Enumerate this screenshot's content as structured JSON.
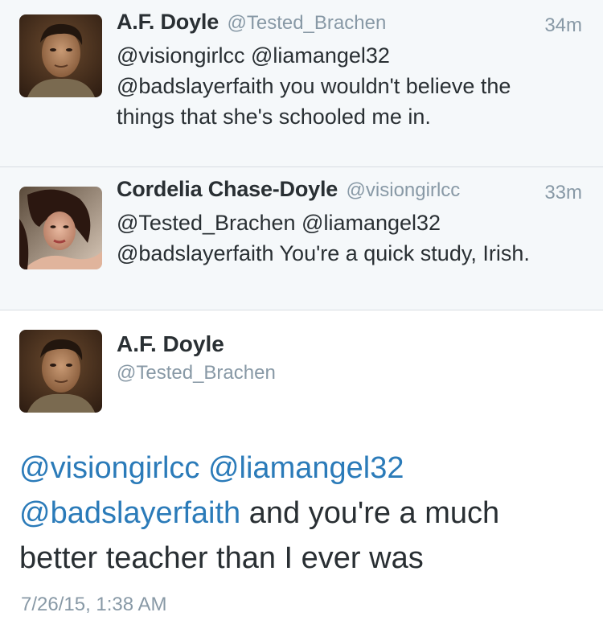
{
  "tweets": [
    {
      "display_name": "A.F. Doyle",
      "handle": "@Tested_Brachen",
      "time": "34m",
      "text_line1": "@visiongirlcc @liamangel32",
      "text_line2": "@badslayerfaith you wouldn't believe the",
      "text_line3": "things that she's schooled me in."
    },
    {
      "display_name": "Cordelia Chase-Doyle",
      "handle": "@visiongirlcc",
      "time": "33m",
      "text_line1": "@Tested_Brachen @liamangel32",
      "text_line2": "@badslayerfaith You're a quick study, Irish."
    }
  ],
  "focus": {
    "display_name": "A.F. Doyle",
    "handle": "@Tested_Brachen",
    "mention1": "@visiongirlcc",
    "mention2": "@liamangel32",
    "mention3": "@badslayerfaith",
    "text_after_mentions": " and you're a much",
    "text_line3": "better teacher than I ever was",
    "date": "7/26/15, 1:38 AM"
  },
  "colors": {
    "link": "#2b7bb9",
    "reply_background": "#f5f8fa",
    "secondary_text": "#8899a6",
    "primary_text": "#292f33"
  }
}
